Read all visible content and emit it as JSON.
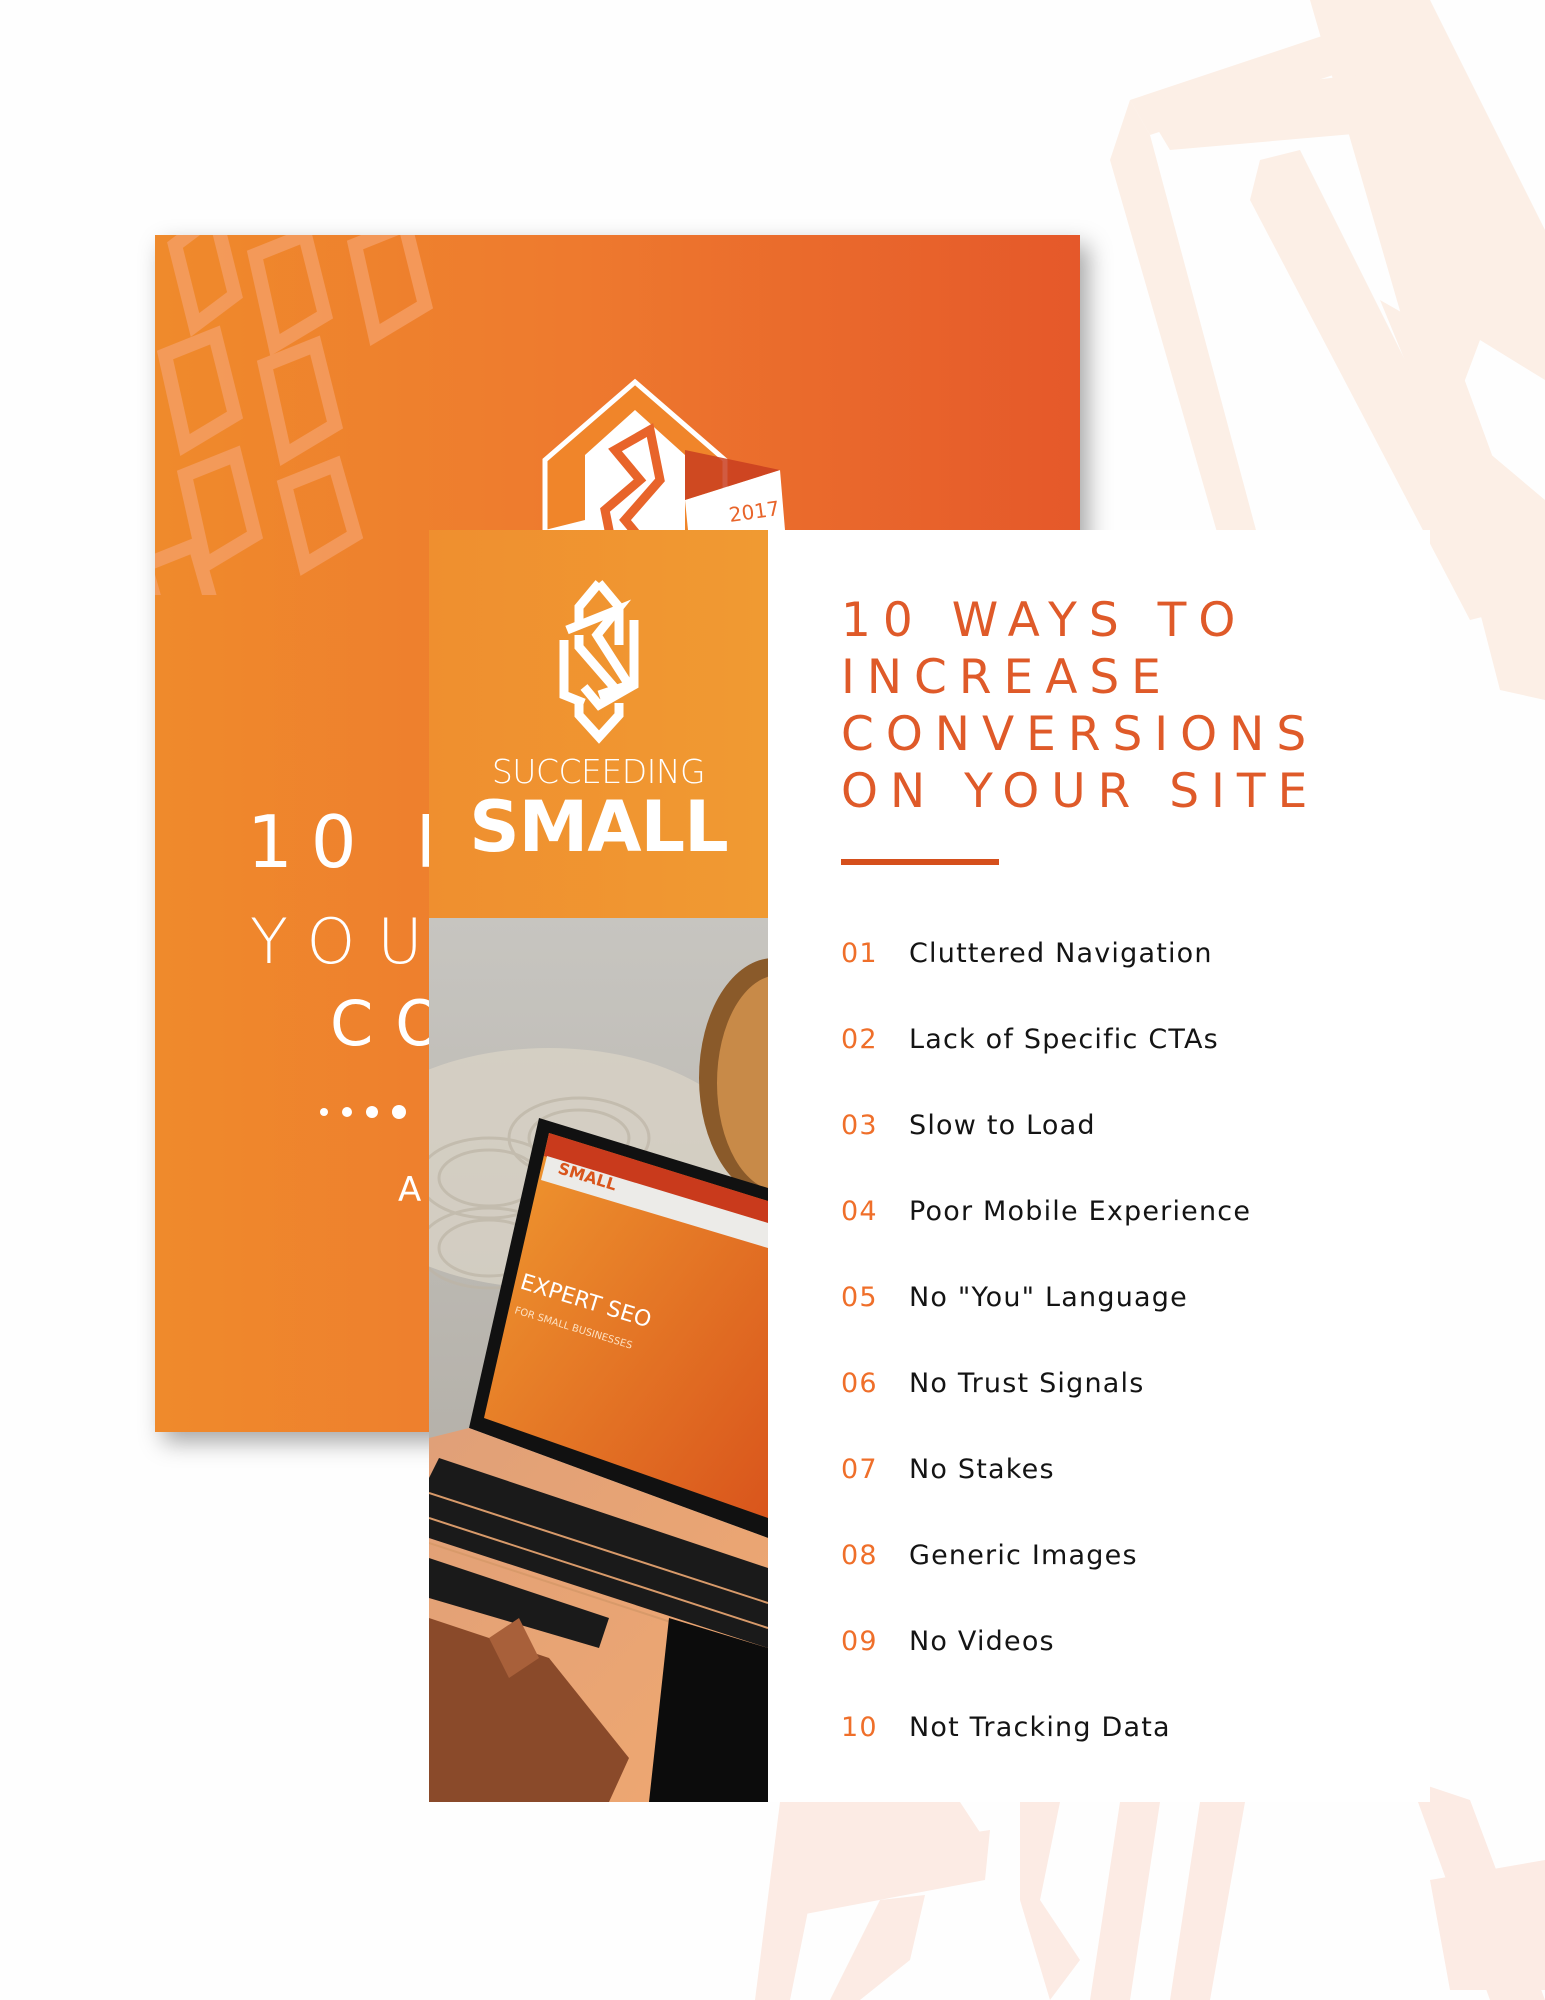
{
  "colors": {
    "brand_orange": "#ef8a2c",
    "brand_red_orange": "#e5582a",
    "headline": "#df5a29",
    "accent_bar": "#d54f1c",
    "step_number": "#ef6f2a",
    "step_text": "#141414",
    "background_pattern": "#fcebe2"
  },
  "back_card": {
    "badge_year": "2017",
    "title_partial": "10 R",
    "subtitle_line1_partial": "YOU",
    "subtitle_line2_partial": "CO",
    "author_partial": "A"
  },
  "front_card": {
    "brand": {
      "line1": "SUCCEEDING",
      "line2": "SMALL"
    },
    "photo": {
      "description": "laptop displaying website",
      "screen_headline": "EXPERT SEO",
      "screen_subheadline": "FOR SMALL BUSINESSES",
      "screen_brand": "SMALL"
    },
    "headline_lines": [
      "10 WAYS TO",
      "INCREASE",
      "CONVERSIONS",
      "ON YOUR SITE"
    ],
    "steps": [
      {
        "number": "01",
        "label": "Cluttered Navigation"
      },
      {
        "number": "02",
        "label": "Lack of Specific CTAs"
      },
      {
        "number": "03",
        "label": "Slow to Load"
      },
      {
        "number": "04",
        "label": "Poor Mobile Experience"
      },
      {
        "number": "05",
        "label": "No \"You\" Language"
      },
      {
        "number": "06",
        "label": "No Trust Signals"
      },
      {
        "number": "07",
        "label": "No Stakes"
      },
      {
        "number": "08",
        "label": "Generic Images"
      },
      {
        "number": "09",
        "label": "No Videos"
      },
      {
        "number": "10",
        "label": "Not Tracking Data"
      }
    ]
  }
}
